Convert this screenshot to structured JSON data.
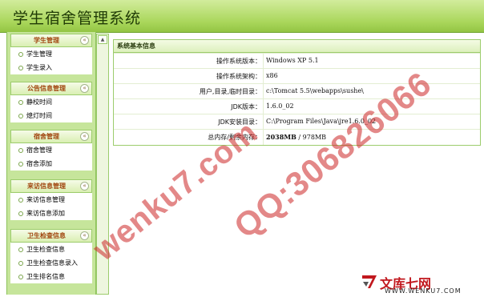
{
  "app": {
    "title": "学生宿舍管理系统"
  },
  "sidebar": {
    "sections": [
      {
        "title": "学生管理",
        "items": [
          "学生管理",
          "学生录入"
        ]
      },
      {
        "title": "公告信息管理",
        "items": [
          "静校时间",
          "熄灯时间"
        ]
      },
      {
        "title": "宿舍管理",
        "items": [
          "宿舍管理",
          "宿舍添加"
        ]
      },
      {
        "title": "来访信息管理",
        "items": [
          "来访信息管理",
          "来访信息添加"
        ]
      },
      {
        "title": "卫生检查信息",
        "items": [
          "卫生检查信息",
          "卫生检查信息录入",
          "卫生排名信息"
        ]
      }
    ],
    "collapse_glyph": "«",
    "scroll_up_glyph": "▲"
  },
  "panel": {
    "title": "系统基本信息",
    "rows": [
      {
        "label": "操作系统版本：",
        "value": "Windows XP  5.1"
      },
      {
        "label": "操作系统架构：",
        "value": "x86"
      },
      {
        "label": "用户,目录,临时目录：",
        "value": "c:\\Tomcat 5.5\\webapps\\sushe\\"
      },
      {
        "label": "JDK版本：",
        "value": "1.6.0_02"
      },
      {
        "label": "JDK安装目录：",
        "value": "C:\\Program Files\\Java\\jre1.6.0_02"
      },
      {
        "label": "总内存/剩余内存：",
        "value_bold": "2038MB",
        "value_rest": " / 978MB"
      }
    ]
  },
  "watermark": {
    "text1": "wenku7.com",
    "text2": "QQ:306826066",
    "color": "#cc2626"
  },
  "logo": {
    "name": "文库七网",
    "url": "WWW.WENKU7.COM"
  },
  "colors": {
    "header_green": "#a9d65a",
    "sidebar_green": "#c6e59b",
    "section_title": "#a1450f"
  }
}
